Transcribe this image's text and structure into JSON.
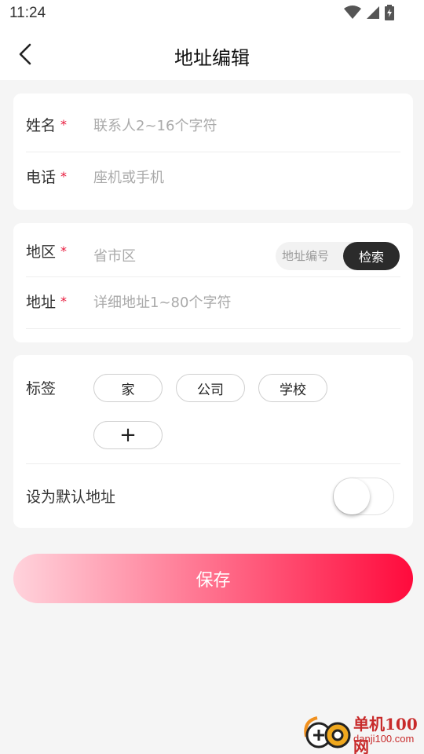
{
  "status_bar": {
    "time": "11:24",
    "icons": [
      "wifi-icon",
      "signal-icon",
      "battery-icon"
    ]
  },
  "header": {
    "back_icon": "back-arrow-icon",
    "title": "地址编辑"
  },
  "contact": {
    "name_label": "姓名",
    "name_required": "*",
    "name_placeholder": "联系人2~16个字符",
    "name_value": "",
    "phone_label": "电话",
    "phone_required": "*",
    "phone_placeholder": "座机或手机",
    "phone_value": ""
  },
  "address": {
    "region_label": "地区",
    "region_required": "*",
    "region_placeholder": "省市区",
    "region_value": "",
    "code_placeholder": "地址编号",
    "search_label": "检索",
    "detail_label": "地址",
    "detail_required": "*",
    "detail_placeholder": "详细地址1~80个字符",
    "detail_value": ""
  },
  "tags": {
    "label": "标签",
    "items": [
      "家",
      "公司",
      "学校"
    ],
    "add_label": "+"
  },
  "default_address": {
    "label": "设为默认地址",
    "enabled": false
  },
  "save_label": "保存",
  "watermark": {
    "title": "单机100网",
    "url": "danji100.com"
  },
  "colors": {
    "accent": "#ff0a3c",
    "required": "#e8173a",
    "background": "#f5f5f5",
    "search_button": "#2b2b2b"
  }
}
